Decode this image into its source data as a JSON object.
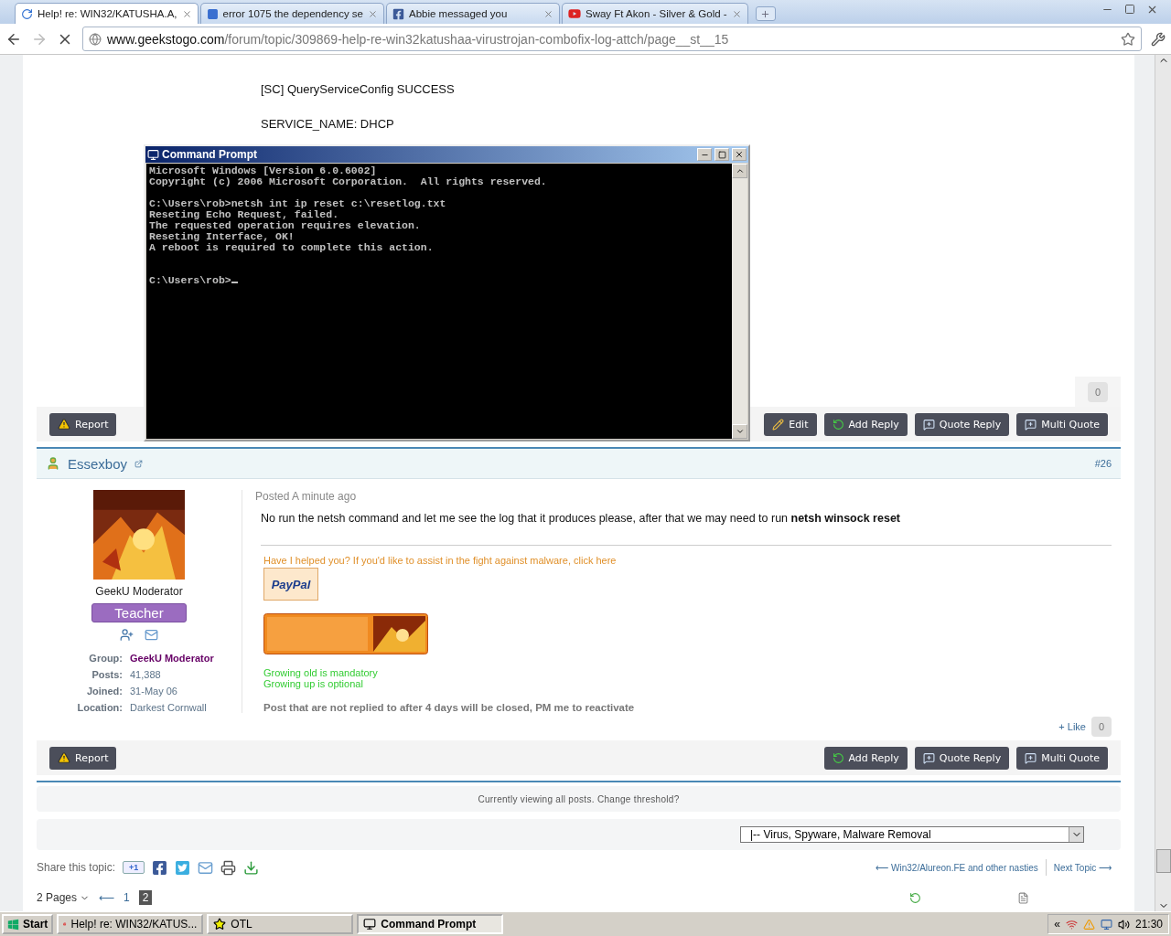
{
  "browser": {
    "tabs": [
      {
        "title": "Help! re: WIN32/KATUSHA.A,",
        "kind": "loading",
        "selected": true
      },
      {
        "title": "error 1075 the dependency se",
        "kind": "mail",
        "selected": false
      },
      {
        "title": "Abbie messaged you",
        "kind": "social",
        "selected": false
      },
      {
        "title": "Sway Ft Akon - Silver & Gold -",
        "kind": "video",
        "selected": false
      }
    ],
    "loading": true,
    "url_host": "www.geekstogo.com",
    "url_path": "/forum/topic/309869-help-re-win32katushaa-virustrojan-combofix-log-attch/page__st__15"
  },
  "previous_post": {
    "code_paragraphs": [
      "[SC] QueryServiceConfig SUCCESS",
      "SERVICE_NAME: DHCP"
    ],
    "like_count": "0",
    "actions_left": [
      {
        "label": "Report",
        "kind": "report"
      }
    ],
    "actions_right": [
      {
        "label": "Edit",
        "kind": "edit"
      },
      {
        "label": "Add Reply",
        "kind": "reply"
      },
      {
        "label": "Quote Reply",
        "kind": "quote"
      },
      {
        "label": "Multi Quote",
        "kind": "quote"
      }
    ]
  },
  "post": {
    "author": "Essexboy",
    "number": "#26",
    "member_title": "GeekU Moderator",
    "badge": "Teacher",
    "stats": [
      {
        "label": "Group:",
        "value": "GeekU Moderator",
        "kind": "group"
      },
      {
        "label": "Posts:",
        "value": "41,388",
        "kind": "plain"
      },
      {
        "label": "Joined:",
        "value": "31-May 06",
        "kind": "plain"
      },
      {
        "label": "Location:",
        "value": "Darkest Cornwall",
        "kind": "plain"
      }
    ],
    "posted": "Posted A minute ago",
    "body": "No run the netsh command and let me see the log that it produces please, after that we may need to run **netsh winsock reset**",
    "signature_link": "Have I helped you? If you'd like to assist in the fight against malware, click here",
    "paypal": "PayPal",
    "signature_lines": [
      "Growing old is mandatory",
      "Growing up is optional"
    ],
    "signature_note": "Post that are not replied to after 4 days will be closed, PM me to reactivate",
    "like_label": "+ Like",
    "like_count": "0",
    "actions_left": [
      {
        "label": "Report",
        "kind": "report"
      }
    ],
    "actions_right": [
      {
        "label": "Add Reply",
        "kind": "reply"
      },
      {
        "label": "Quote Reply",
        "kind": "quote"
      },
      {
        "label": "Multi Quote",
        "kind": "quote"
      }
    ]
  },
  "footer": {
    "threshold": "Currently viewing all posts. Change threshold?",
    "forum_select": "|-- Virus, Spyware, Malware Removal",
    "share_label": "Share this topic:",
    "share": [
      {
        "kind": "gplus",
        "label": "+1"
      },
      {
        "kind": "facebook"
      },
      {
        "kind": "twitter"
      },
      {
        "kind": "email"
      },
      {
        "kind": "print"
      },
      {
        "kind": "download"
      }
    ],
    "prev_topic": "⟵ Win32/Alureon.FE and other nasties",
    "next_topic": "Next Topic ⟶",
    "pages_label": "2 Pages",
    "page_prev": "⟵",
    "pages": [
      {
        "label": "1",
        "selected": false
      },
      {
        "label": "2",
        "selected": true
      }
    ]
  },
  "cmd": {
    "title": "Command Prompt",
    "blocks": [
      [
        "Microsoft Windows [Version 6.0.6002]",
        "Copyright (c) 2006 Microsoft Corporation.  All rights reserved."
      ],
      [
        "C:\\Users\\rob>netsh int ip reset c:\\resetlog.txt",
        "Reseting Echo Request, failed.",
        "The requested operation requires elevation.",
        "Reseting Interface, OK!",
        "A reboot is required to complete this action."
      ]
    ],
    "prompt": "C:\\Users\\rob>"
  },
  "taskbar": {
    "start": "Start",
    "items": [
      {
        "label": "Help! re: WIN32/KATUS...",
        "kind": "browser",
        "selected": false
      },
      {
        "label": "OTL",
        "kind": "tool",
        "selected": false
      },
      {
        "label": "Command Prompt",
        "kind": "console",
        "selected": true
      }
    ],
    "tray_expand": "«",
    "clock": "21:30"
  }
}
